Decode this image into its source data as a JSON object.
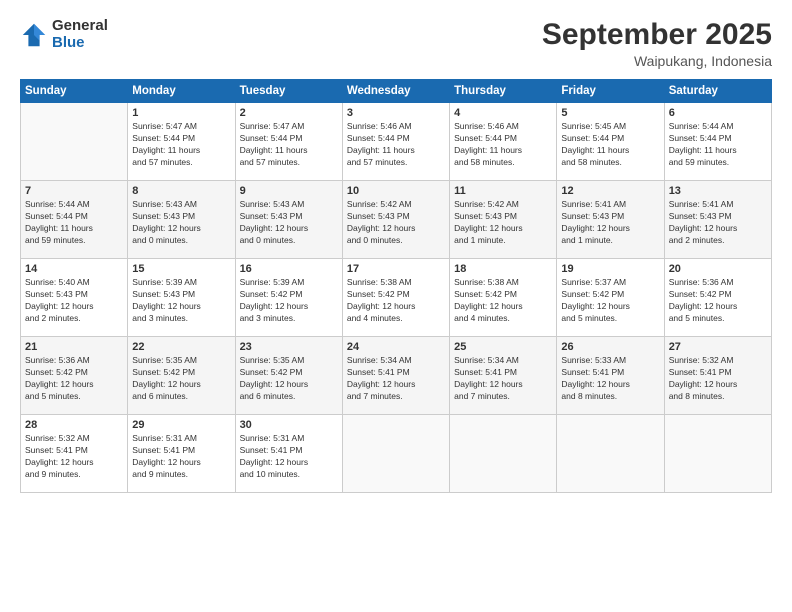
{
  "logo": {
    "general": "General",
    "blue": "Blue"
  },
  "title": "September 2025",
  "subtitle": "Waipukang, Indonesia",
  "headers": [
    "Sunday",
    "Monday",
    "Tuesday",
    "Wednesday",
    "Thursday",
    "Friday",
    "Saturday"
  ],
  "weeks": [
    [
      {
        "day": "",
        "info": ""
      },
      {
        "day": "1",
        "info": "Sunrise: 5:47 AM\nSunset: 5:44 PM\nDaylight: 11 hours\nand 57 minutes."
      },
      {
        "day": "2",
        "info": "Sunrise: 5:47 AM\nSunset: 5:44 PM\nDaylight: 11 hours\nand 57 minutes."
      },
      {
        "day": "3",
        "info": "Sunrise: 5:46 AM\nSunset: 5:44 PM\nDaylight: 11 hours\nand 57 minutes."
      },
      {
        "day": "4",
        "info": "Sunrise: 5:46 AM\nSunset: 5:44 PM\nDaylight: 11 hours\nand 58 minutes."
      },
      {
        "day": "5",
        "info": "Sunrise: 5:45 AM\nSunset: 5:44 PM\nDaylight: 11 hours\nand 58 minutes."
      },
      {
        "day": "6",
        "info": "Sunrise: 5:44 AM\nSunset: 5:44 PM\nDaylight: 11 hours\nand 59 minutes."
      }
    ],
    [
      {
        "day": "7",
        "info": "Sunrise: 5:44 AM\nSunset: 5:44 PM\nDaylight: 11 hours\nand 59 minutes."
      },
      {
        "day": "8",
        "info": "Sunrise: 5:43 AM\nSunset: 5:43 PM\nDaylight: 12 hours\nand 0 minutes."
      },
      {
        "day": "9",
        "info": "Sunrise: 5:43 AM\nSunset: 5:43 PM\nDaylight: 12 hours\nand 0 minutes."
      },
      {
        "day": "10",
        "info": "Sunrise: 5:42 AM\nSunset: 5:43 PM\nDaylight: 12 hours\nand 0 minutes."
      },
      {
        "day": "11",
        "info": "Sunrise: 5:42 AM\nSunset: 5:43 PM\nDaylight: 12 hours\nand 1 minute."
      },
      {
        "day": "12",
        "info": "Sunrise: 5:41 AM\nSunset: 5:43 PM\nDaylight: 12 hours\nand 1 minute."
      },
      {
        "day": "13",
        "info": "Sunrise: 5:41 AM\nSunset: 5:43 PM\nDaylight: 12 hours\nand 2 minutes."
      }
    ],
    [
      {
        "day": "14",
        "info": "Sunrise: 5:40 AM\nSunset: 5:43 PM\nDaylight: 12 hours\nand 2 minutes."
      },
      {
        "day": "15",
        "info": "Sunrise: 5:39 AM\nSunset: 5:43 PM\nDaylight: 12 hours\nand 3 minutes."
      },
      {
        "day": "16",
        "info": "Sunrise: 5:39 AM\nSunset: 5:42 PM\nDaylight: 12 hours\nand 3 minutes."
      },
      {
        "day": "17",
        "info": "Sunrise: 5:38 AM\nSunset: 5:42 PM\nDaylight: 12 hours\nand 4 minutes."
      },
      {
        "day": "18",
        "info": "Sunrise: 5:38 AM\nSunset: 5:42 PM\nDaylight: 12 hours\nand 4 minutes."
      },
      {
        "day": "19",
        "info": "Sunrise: 5:37 AM\nSunset: 5:42 PM\nDaylight: 12 hours\nand 5 minutes."
      },
      {
        "day": "20",
        "info": "Sunrise: 5:36 AM\nSunset: 5:42 PM\nDaylight: 12 hours\nand 5 minutes."
      }
    ],
    [
      {
        "day": "21",
        "info": "Sunrise: 5:36 AM\nSunset: 5:42 PM\nDaylight: 12 hours\nand 5 minutes."
      },
      {
        "day": "22",
        "info": "Sunrise: 5:35 AM\nSunset: 5:42 PM\nDaylight: 12 hours\nand 6 minutes."
      },
      {
        "day": "23",
        "info": "Sunrise: 5:35 AM\nSunset: 5:42 PM\nDaylight: 12 hours\nand 6 minutes."
      },
      {
        "day": "24",
        "info": "Sunrise: 5:34 AM\nSunset: 5:41 PM\nDaylight: 12 hours\nand 7 minutes."
      },
      {
        "day": "25",
        "info": "Sunrise: 5:34 AM\nSunset: 5:41 PM\nDaylight: 12 hours\nand 7 minutes."
      },
      {
        "day": "26",
        "info": "Sunrise: 5:33 AM\nSunset: 5:41 PM\nDaylight: 12 hours\nand 8 minutes."
      },
      {
        "day": "27",
        "info": "Sunrise: 5:32 AM\nSunset: 5:41 PM\nDaylight: 12 hours\nand 8 minutes."
      }
    ],
    [
      {
        "day": "28",
        "info": "Sunrise: 5:32 AM\nSunset: 5:41 PM\nDaylight: 12 hours\nand 9 minutes."
      },
      {
        "day": "29",
        "info": "Sunrise: 5:31 AM\nSunset: 5:41 PM\nDaylight: 12 hours\nand 9 minutes."
      },
      {
        "day": "30",
        "info": "Sunrise: 5:31 AM\nSunset: 5:41 PM\nDaylight: 12 hours\nand 10 minutes."
      },
      {
        "day": "",
        "info": ""
      },
      {
        "day": "",
        "info": ""
      },
      {
        "day": "",
        "info": ""
      },
      {
        "day": "",
        "info": ""
      }
    ]
  ]
}
